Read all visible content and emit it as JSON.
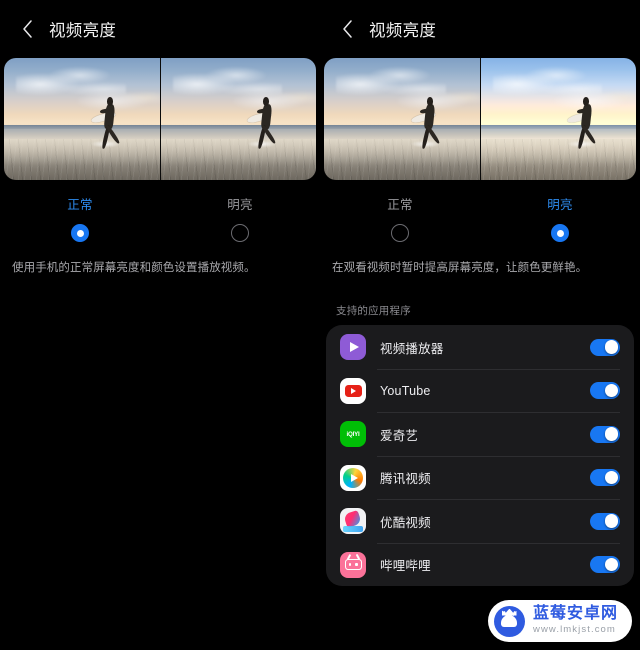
{
  "panels": [
    {
      "header": {
        "title": "视频亮度",
        "back_icon": "chevron-left-icon"
      },
      "preview": {
        "left_variant": "normal",
        "right_variant": "normal"
      },
      "options": [
        {
          "label": "正常",
          "selected": true
        },
        {
          "label": "明亮",
          "selected": false
        }
      ],
      "description": "使用手机的正常屏幕亮度和颜色设置播放视频。",
      "has_apps_section": false
    },
    {
      "header": {
        "title": "视频亮度",
        "back_icon": "chevron-left-icon"
      },
      "preview": {
        "left_variant": "normal",
        "right_variant": "bright"
      },
      "options": [
        {
          "label": "正常",
          "selected": false
        },
        {
          "label": "明亮",
          "selected": true
        }
      ],
      "description": "在观看视频时暂时提高屏幕亮度，让颜色更鲜艳。",
      "has_apps_section": true,
      "apps_section": {
        "caption": "支持的应用程序",
        "apps": [
          {
            "name": "视频播放器",
            "icon": "video-player-icon",
            "enabled": true
          },
          {
            "name": "YouTube",
            "icon": "youtube-icon",
            "enabled": true
          },
          {
            "name": "爱奇艺",
            "icon": "iqiyi-icon",
            "icon_text": "iQIYI",
            "enabled": true
          },
          {
            "name": "腾讯视频",
            "icon": "tencent-video-icon",
            "enabled": true
          },
          {
            "name": "优酷视频",
            "icon": "youku-icon",
            "enabled": true
          },
          {
            "name": "哔哩哔哩",
            "icon": "bilibili-icon",
            "enabled": true
          }
        ]
      }
    }
  ],
  "watermark": {
    "title": "蓝莓安卓网",
    "url": "www.lmkjst.com",
    "logo_icon": "android-robot-icon"
  },
  "colors": {
    "background": "#000000",
    "accent": "#1877f2",
    "accent_text": "#2e8cf0",
    "card": "#1b1b1d",
    "divider": "#2e2e31",
    "primary_text": "#ededf0",
    "secondary_text": "#a9a9ad",
    "caption_text": "#8b8b90",
    "switch_off": "#3a3a3c",
    "watermark_brand": "#2f5be0"
  }
}
